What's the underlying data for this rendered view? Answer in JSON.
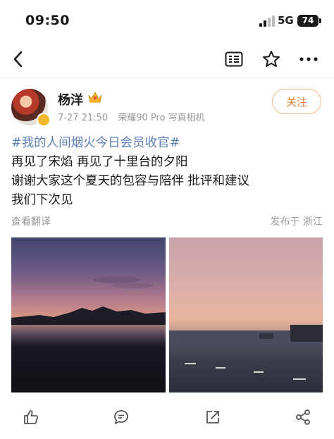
{
  "status_bar": {
    "time": "09:50",
    "network": "5G",
    "battery": "74"
  },
  "nav": {
    "back_icon": "chevron-left-icon",
    "reader_icon": "reader-mode-icon",
    "favorite_icon": "star-icon",
    "more_icon": "more-dots-icon"
  },
  "author": {
    "name": "杨洋",
    "badge_icon": "crown-icon",
    "date": "7-27 21:50",
    "device": "荣耀90 Pro 写真相机",
    "follow_label": "关注"
  },
  "post": {
    "hashtag": "#我的人间烟火今日会员收官#",
    "lines": [
      "再见了宋焰 再见了十里台的夕阳",
      "谢谢大家这个夏天的包容与陪伴 批评和建议",
      "我们下次见"
    ],
    "translate_label": "查看翻译",
    "location": "发布于 浙江"
  },
  "images": [
    {
      "description_icon": "photo-sunset-hills"
    },
    {
      "description_icon": "photo-sunset-road"
    }
  ],
  "actions": {
    "like_icon": "thumbs-up-icon",
    "comment_icon": "comment-icon",
    "repost_icon": "repost-icon",
    "share_icon": "share-icon"
  },
  "colors": {
    "hashtag": "#5b7fb5",
    "follow_accent": "#e5813a",
    "meta_gray": "#999999"
  }
}
